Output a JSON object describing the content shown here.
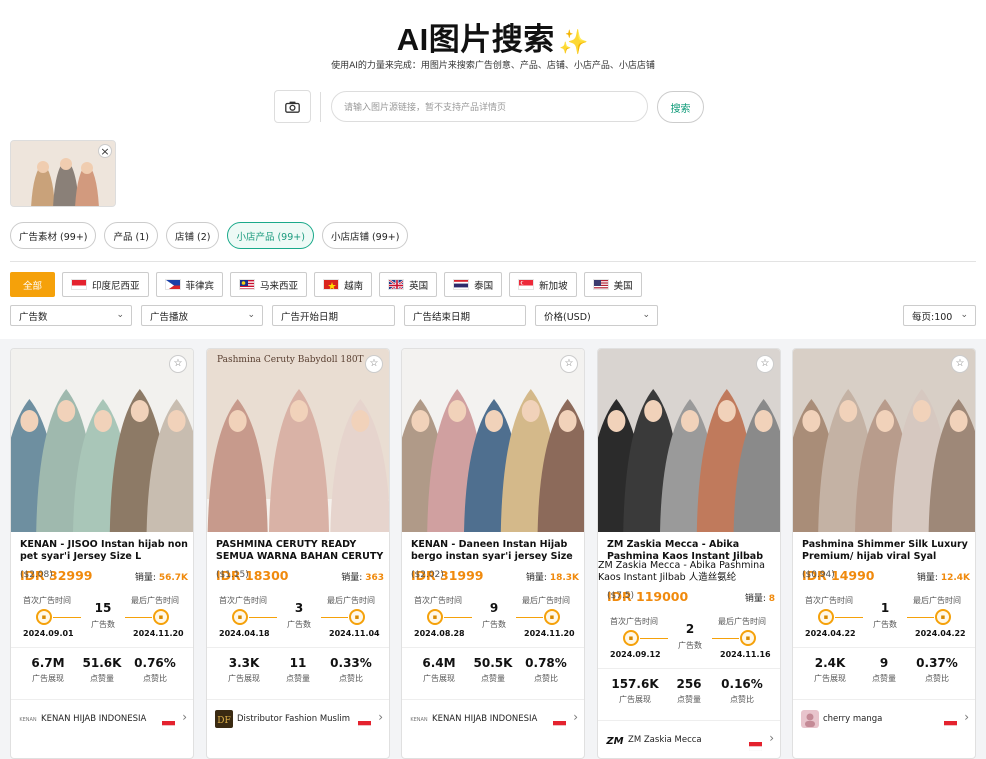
{
  "header": {
    "title": "AI图片搜索",
    "subtitle": "使用AI的力量来完成：用图片来搜索广告创意、产品、店铺、小店产品、小店店铺"
  },
  "search": {
    "placeholder": "请输入图片源链接，暂不支持产品详情页",
    "button_label": "搜索"
  },
  "tabs": [
    {
      "label": "广告素材 (99+)",
      "active": false
    },
    {
      "label": "产品 (1)",
      "active": false
    },
    {
      "label": "店铺 (2)",
      "active": false
    },
    {
      "label": "小店产品 (99+)",
      "active": true
    },
    {
      "label": "小店店铺 (99+)",
      "active": false
    }
  ],
  "countries": {
    "all_label": "全部",
    "items": [
      {
        "label": "印度尼西亚",
        "flag": "indonesia-flag-icon"
      },
      {
        "label": "菲律宾",
        "flag": "philippines-flag-icon"
      },
      {
        "label": "马来西亚",
        "flag": "malaysia-flag-icon"
      },
      {
        "label": "越南",
        "flag": "vietnam-flag-icon"
      },
      {
        "label": "英国",
        "flag": "uk-flag-icon"
      },
      {
        "label": "泰国",
        "flag": "thailand-flag-icon"
      },
      {
        "label": "新加坡",
        "flag": "singapore-flag-icon"
      },
      {
        "label": "美国",
        "flag": "usa-flag-icon"
      }
    ]
  },
  "filters": {
    "ad_count": "广告数",
    "ad_play": "广告播放",
    "ad_start": "广告开始日期",
    "ad_end": "广告结束日期",
    "price": "价格(USD)",
    "per_page": "每页:100"
  },
  "labels": {
    "first_ad": "首次广告时间",
    "last_ad": "最后广告时间",
    "ad_count": "广告数",
    "impressions": "广告展现",
    "likes": "点赞量",
    "like_ratio": "点赞比",
    "sales": "销量:"
  },
  "colors": {
    "accent": "#f5a10a",
    "price": "#f08a0d",
    "active_tab": "#1aa98a"
  },
  "products": [
    {
      "img_text": "",
      "title": "KENAN - JISOO Instan hijab non pet syar'i Jersey Size L",
      "subtitle": "",
      "price": "IDR 32999",
      "usd": "($2.08)",
      "sales": "56.7K",
      "ad_count": "15",
      "first_date": "2024.09.01",
      "last_date": "2024.11.20",
      "impressions": "6.7M",
      "likes": "51.6K",
      "ratio": "0.76%",
      "seller": "KENAN HIJAB INDONESIA",
      "seller_logo": "kenan-logo-icon"
    },
    {
      "img_text": "Pashmina Ceruty Babydoll 180T",
      "title": "PASHMINA CERUTY READY SEMUA WARNA BAHAN CERUTY BABYDO...",
      "subtitle": "",
      "price": "IDR 18300",
      "usd": "($1.15)",
      "sales": "363",
      "ad_count": "3",
      "first_date": "2024.04.18",
      "last_date": "2024.11.04",
      "impressions": "3.3K",
      "likes": "11",
      "ratio": "0.33%",
      "seller": "Distributor Fashion Muslim",
      "seller_logo": "df-logo-icon"
    },
    {
      "img_text": "",
      "title": "KENAN - Daneen Instan Hijab bergo instan syar'i jersey Size L",
      "subtitle": "",
      "price": "IDR 31999",
      "usd": "($2.02)",
      "sales": "18.3K",
      "ad_count": "9",
      "first_date": "2024.08.28",
      "last_date": "2024.11.20",
      "impressions": "6.4M",
      "likes": "50.5K",
      "ratio": "0.78%",
      "seller": "KENAN HIJAB INDONESIA",
      "seller_logo": "kenan-logo-icon"
    },
    {
      "img_text": "",
      "title": "ZM Zaskia Mecca - Abika Pashmina Kaos Instant Jilbab Rayon Spandex",
      "subtitle": "ZM Zaskia Mecca - Abika Pashmina Kaos Instant Jilbab 人造丝氨纶",
      "price": "IDR 119000",
      "usd": "($7.5)",
      "sales": "8",
      "ad_count": "2",
      "first_date": "2024.09.12",
      "last_date": "2024.11.16",
      "impressions": "157.6K",
      "likes": "256",
      "ratio": "0.16%",
      "seller": "ZM Zaskia Mecca",
      "seller_logo": "zm-logo-icon"
    },
    {
      "img_text": "",
      "title": "Pashmina Shimmer Silk Luxury Premium/ hijab viral Syal Muslim",
      "subtitle": "",
      "price": "IDR 14990",
      "usd": "($0.94)",
      "sales": "12.4K",
      "ad_count": "1",
      "first_date": "2024.04.22",
      "last_date": "2024.04.22",
      "impressions": "2.4K",
      "likes": "9",
      "ratio": "0.37%",
      "seller": "cherry manga",
      "seller_logo": "cherry-avatar-icon"
    }
  ]
}
